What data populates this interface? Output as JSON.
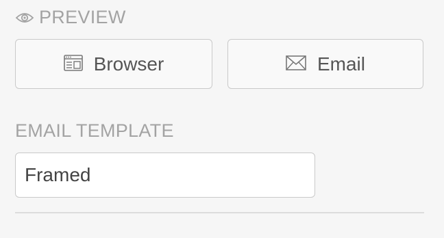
{
  "preview": {
    "label": "PREVIEW",
    "icon": "eye-icon",
    "buttons": [
      {
        "label": "Browser",
        "icon": "browser-window-icon"
      },
      {
        "label": "Email",
        "icon": "envelope-icon"
      }
    ]
  },
  "email_template": {
    "label": "EMAIL TEMPLATE",
    "value": "Framed"
  },
  "colors": {
    "label_gray": "#a3a3a3",
    "border_gray": "#c9c9c9",
    "text_dark": "#555555"
  }
}
